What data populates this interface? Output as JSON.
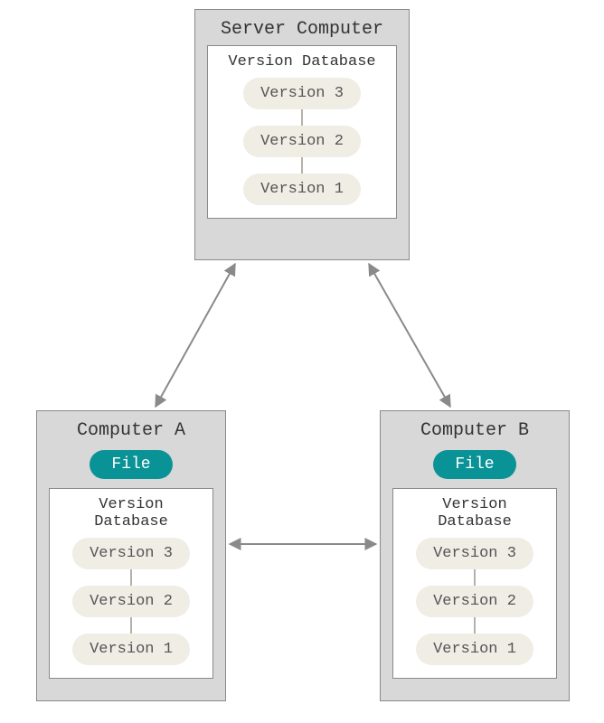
{
  "server": {
    "title": "Server Computer",
    "db": {
      "title": "Version Database",
      "versions": [
        "Version 3",
        "Version 2",
        "Version 1"
      ]
    }
  },
  "computerA": {
    "title": "Computer A",
    "file_label": "File",
    "db": {
      "title": "Version Database",
      "versions": [
        "Version 3",
        "Version 2",
        "Version 1"
      ]
    }
  },
  "computerB": {
    "title": "Computer B",
    "file_label": "File",
    "db": {
      "title": "Version Database",
      "versions": [
        "Version 3",
        "Version 2",
        "Version 1"
      ]
    }
  }
}
